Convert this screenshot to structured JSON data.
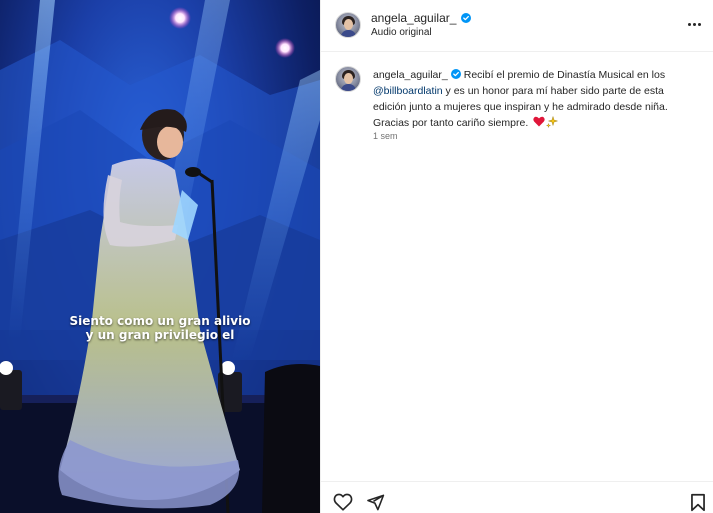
{
  "media": {
    "caption_line1": "Siento como un gran alivio",
    "caption_line2": "y un gran privilegio el"
  },
  "header": {
    "username": "angela_aguilar_",
    "subtitle": "Audio original",
    "more_icon": "more-horizontal-icon"
  },
  "comment": {
    "username": "angela_aguilar_",
    "text_before_mention": "Recibí el premio de Dinastía Musical en los ",
    "mention": "@billboardlatin",
    "text_after_mention": " y es un honor para mí haber sido parte de esta edición junto a mujeres que inspiran y he admirado desde niña. Gracias por tanto cariño siempre. ",
    "emojis": [
      "red-heart-emoji",
      "sparkles-emoji"
    ],
    "time": "1 sem"
  },
  "actions": {
    "like_icon": "heart-icon",
    "share_icon": "send-icon",
    "save_icon": "bookmark-icon"
  },
  "colors": {
    "verified": "#0095f6",
    "mention": "#00376b",
    "text": "#262626",
    "muted": "#737373",
    "border": "#efefef"
  }
}
